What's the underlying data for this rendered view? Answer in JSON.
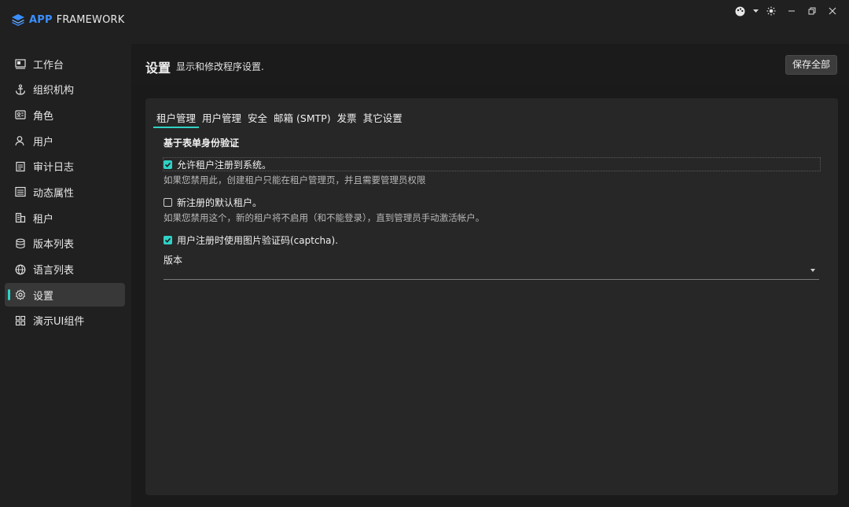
{
  "app": {
    "brand_app": "APP",
    "brand_framework": "FRAMEWORK"
  },
  "window_controls": [
    {
      "name": "theme-palette-icon"
    },
    {
      "name": "dropdown-caret-icon"
    },
    {
      "name": "brightness-icon"
    },
    {
      "name": "minimize-icon"
    },
    {
      "name": "restore-icon"
    },
    {
      "name": "close-icon"
    }
  ],
  "sidebar": {
    "items": [
      {
        "label": "工作台",
        "icon": "dashboard-icon"
      },
      {
        "label": "组织机构",
        "icon": "anchor-icon"
      },
      {
        "label": "角色",
        "icon": "role-card-icon"
      },
      {
        "label": "用户",
        "icon": "user-icon"
      },
      {
        "label": "审计日志",
        "icon": "audit-log-icon"
      },
      {
        "label": "动态属性",
        "icon": "dynamic-property-icon"
      },
      {
        "label": "租户",
        "icon": "tenant-building-icon"
      },
      {
        "label": "版本列表",
        "icon": "database-icon"
      },
      {
        "label": "语言列表",
        "icon": "globe-icon"
      },
      {
        "label": "设置",
        "icon": "gear-icon",
        "active": true
      },
      {
        "label": "演示UI组件",
        "icon": "grid-components-icon"
      }
    ]
  },
  "header": {
    "title": "设置",
    "subtitle": "显示和修改程序设置.",
    "save_label": "保存全部"
  },
  "tabs": [
    {
      "label": "租户管理",
      "active": true
    },
    {
      "label": "用户管理"
    },
    {
      "label": "安全"
    },
    {
      "label": "邮箱 (SMTP)"
    },
    {
      "label": "发票"
    },
    {
      "label": "其它设置"
    }
  ],
  "form": {
    "section_title": "基于表单身份验证",
    "allow_registration": {
      "label": "允许租户注册到系统。",
      "checked": true,
      "help": "如果您禁用此，创建租户只能在租户管理页，并且需要管理员权限"
    },
    "default_active": {
      "label": "新注册的默认租户。",
      "checked": false,
      "help": "如果您禁用这个，新的租户将不启用（和不能登录），直到管理员手动激活帐户。"
    },
    "captcha": {
      "label": "用户注册时使用图片验证码(captcha).",
      "checked": true
    },
    "edition": {
      "label": "版本",
      "value": ""
    }
  },
  "colors": {
    "accent": "#2fd2c6",
    "brand_blue": "#3a8fff"
  }
}
